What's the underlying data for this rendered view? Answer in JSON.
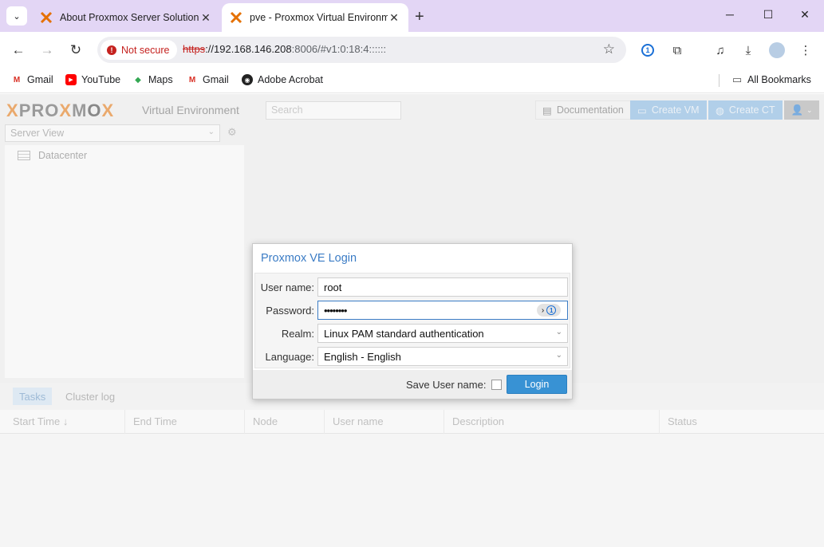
{
  "browser": {
    "tabs": [
      {
        "title": "About Proxmox Server Solution",
        "active": false
      },
      {
        "title": "pve - Proxmox Virtual Environme",
        "active": true
      }
    ],
    "new_tab": "+",
    "window_controls": {
      "minimize": "─",
      "maximize": "☐",
      "close": "✕"
    },
    "security_label": "Not secure",
    "url_scheme": "https",
    "url_host": "://192.168.146.208",
    "url_rest": ":8006/#v1:0:18:4::::::",
    "bookmarks": [
      "Gmail",
      "YouTube",
      "Maps",
      "Gmail",
      "Adobe Acrobat"
    ],
    "all_bookmarks": "All Bookmarks"
  },
  "proxmox": {
    "logo": {
      "p1": "PRO",
      "x1": "X",
      "m": "M",
      "o": "O",
      "x2": "X"
    },
    "subtitle": "Virtual Environment",
    "search_placeholder": "Search",
    "documentation": "Documentation",
    "create_vm": "Create VM",
    "create_ct": "Create CT",
    "server_view": "Server View",
    "tree_root": "Datacenter",
    "bottom_tabs": [
      "Tasks",
      "Cluster log"
    ],
    "columns": [
      "Start Time ↓",
      "End Time",
      "Node",
      "User name",
      "Description",
      "Status"
    ]
  },
  "login": {
    "title": "Proxmox VE Login",
    "username_label": "User name:",
    "username_value": "root",
    "password_label": "Password:",
    "password_value": "••••••••",
    "realm_label": "Realm:",
    "realm_value": "Linux PAM standard authentication",
    "language_label": "Language:",
    "language_value": "English - English",
    "save_label": "Save User name:",
    "login_button": "Login"
  },
  "colors": {
    "tabstrip": "#e3d6f5",
    "proxmox_orange": "#e57000",
    "login_blue": "#3892d4",
    "title_blue": "#3b7cc5"
  }
}
